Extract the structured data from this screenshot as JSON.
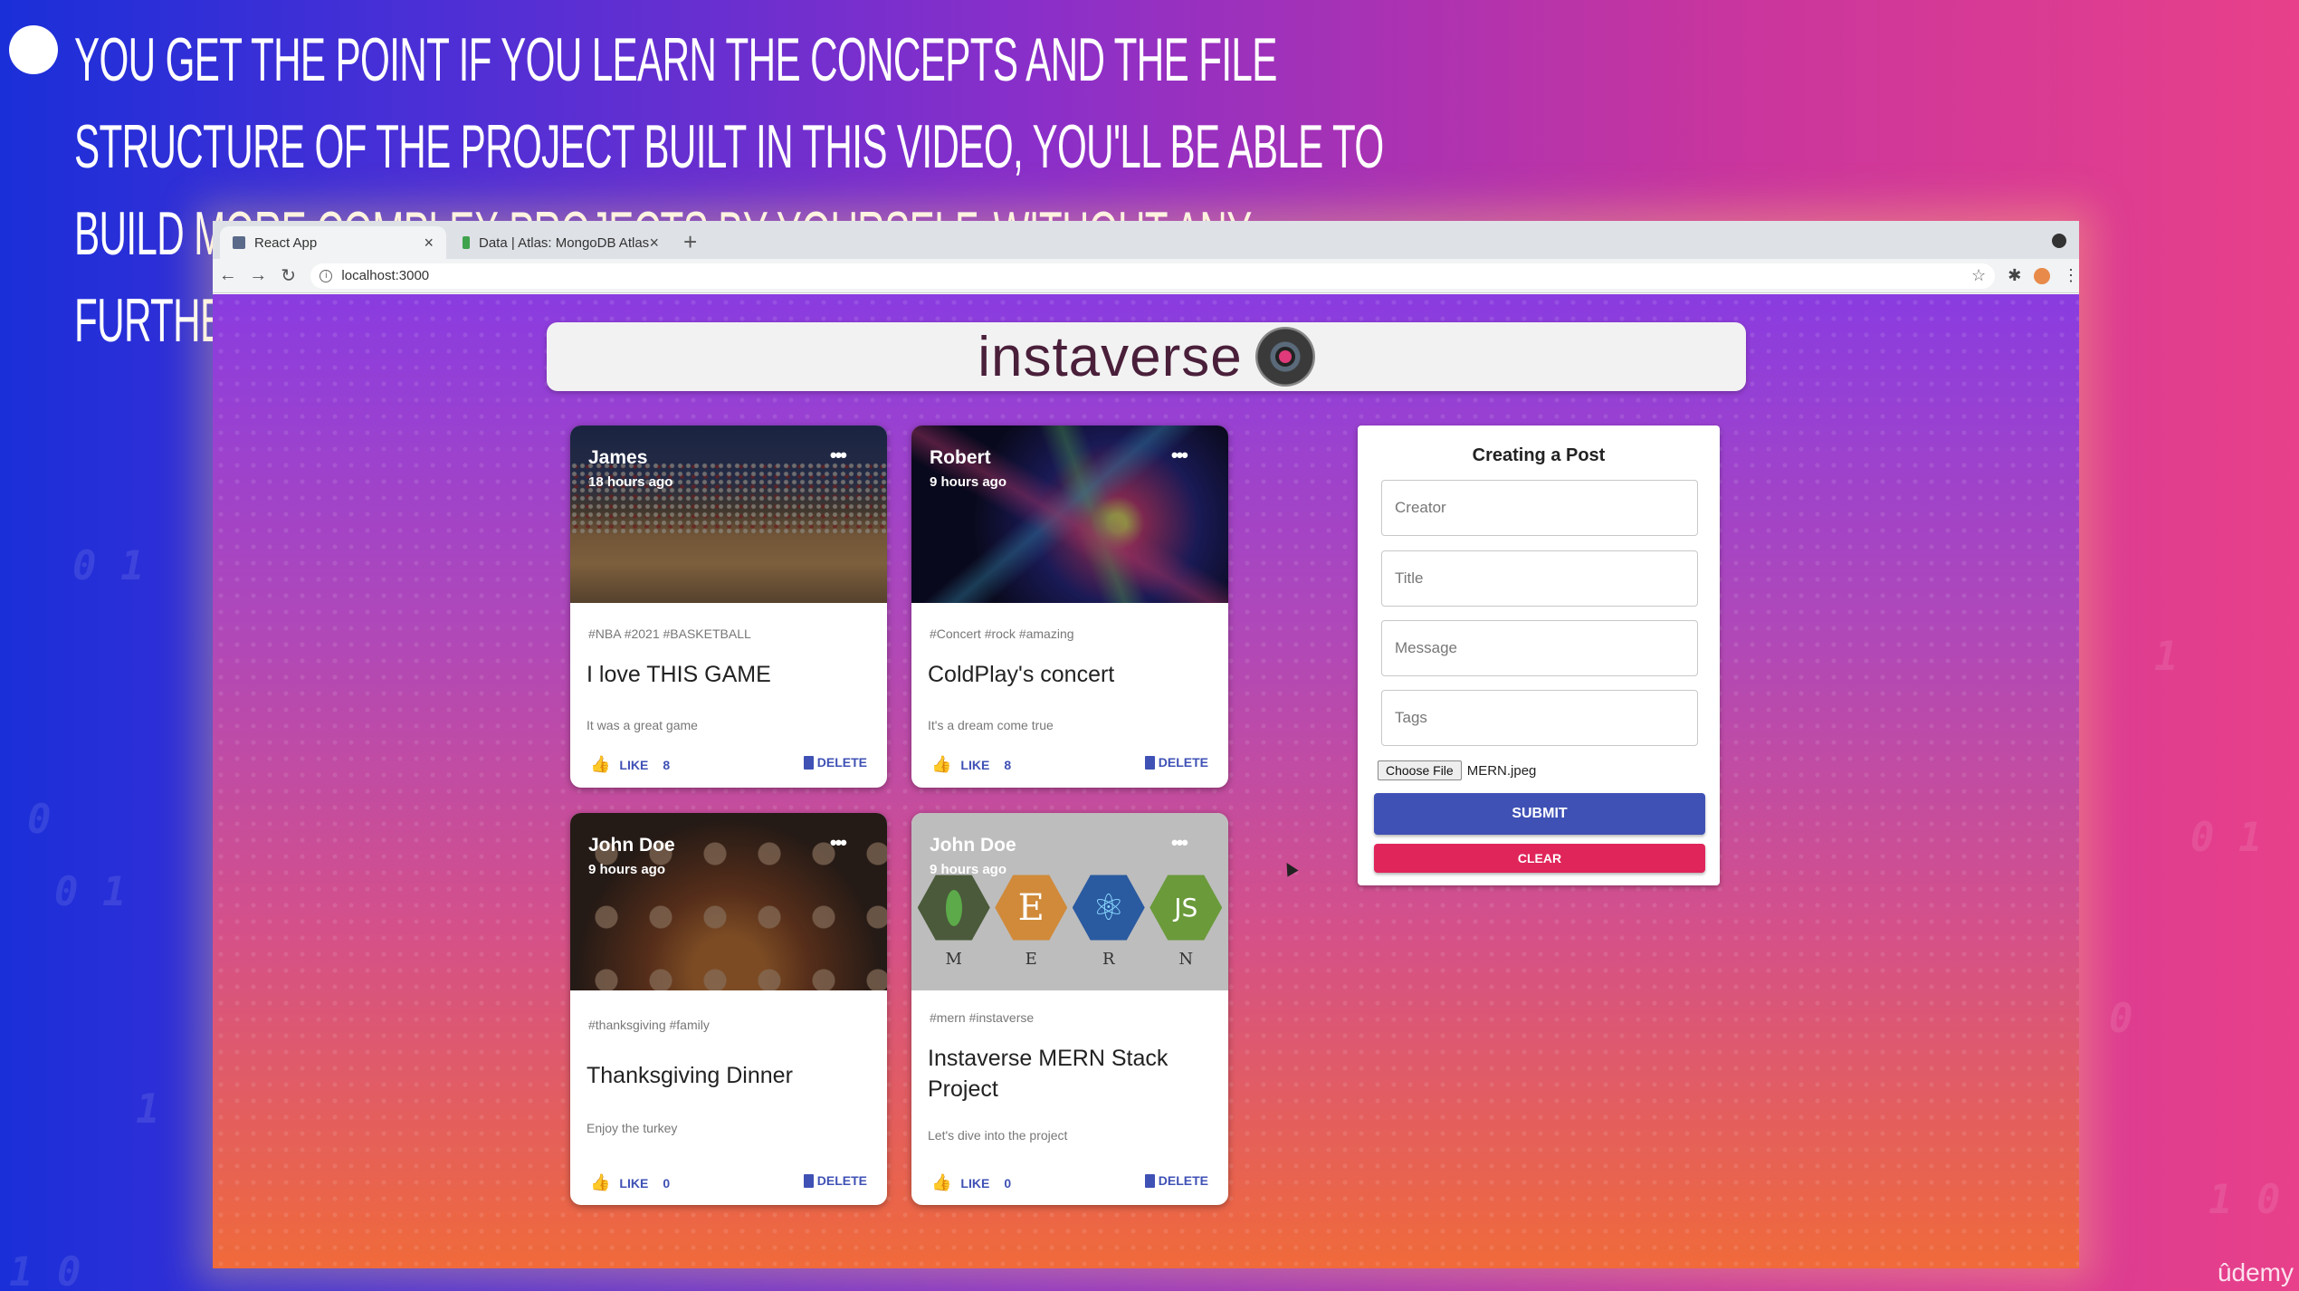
{
  "caption": {
    "text": "YOU GET THE POINT IF YOU LEARN THE CONCEPTS AND THE FILE STRUCTURE OF THE PROJECT BUILT IN THIS VIDEO, YOU'LL BE ABLE TO BUILD MORE COMPLEX PROJECTS BY YOURSELF. WITHOUT ANY FURTHER  ADO"
  },
  "browser": {
    "tabs": [
      {
        "label": "React App",
        "active": true
      },
      {
        "label": "Data | Atlas: MongoDB Atlas",
        "active": false
      }
    ],
    "new_tab": "+",
    "address": "localhost:3000"
  },
  "app": {
    "title": "instaverse"
  },
  "posts": [
    {
      "creator": "James",
      "time": "18 hours ago",
      "tags": "#NBA #2021 #BASKETBALL",
      "title": "I love THIS GAME",
      "message": "It was a great game",
      "like_label": "LIKE",
      "like_count": "8",
      "delete_label": "DELETE"
    },
    {
      "creator": "Robert",
      "time": "9 hours ago",
      "tags": "#Concert #rock #amazing",
      "title": "ColdPlay's concert",
      "message": "It's a dream come true",
      "like_label": "LIKE",
      "like_count": "8",
      "delete_label": "DELETE"
    },
    {
      "creator": "John Doe",
      "time": "9 hours ago",
      "tags": "#thanksgiving #family",
      "title": "Thanksgiving Dinner",
      "message": "Enjoy the turkey",
      "like_label": "LIKE",
      "like_count": "0",
      "delete_label": "DELETE"
    },
    {
      "creator": "John Doe",
      "time": "9 hours ago",
      "tags": "#mern #instaverse",
      "title": "Instaverse MERN Stack Project",
      "message": "Let's dive into the project",
      "like_label": "LIKE",
      "like_count": "0",
      "delete_label": "DELETE"
    }
  ],
  "mern_image": {
    "letters": [
      "M",
      "E",
      "R",
      "N"
    ],
    "glyphs": [
      "",
      "E",
      "⚛",
      "JS"
    ]
  },
  "form": {
    "title": "Creating a Post",
    "fields": {
      "creator": "Creator",
      "title": "Title",
      "message": "Message",
      "tags": "Tags"
    },
    "file_button": "Choose File",
    "file_name": "MERN.jpeg",
    "submit": "SUBMIT",
    "clear": "CLEAR"
  },
  "watermark": "ûdemy",
  "colors": {
    "primary": "#3f51b5",
    "clear": "#e0255a"
  }
}
